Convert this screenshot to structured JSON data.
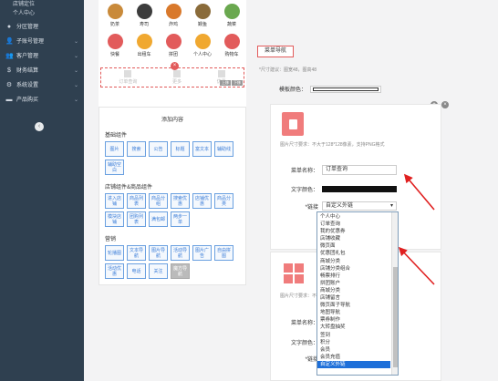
{
  "sidebar": {
    "top_items": [
      "店铺定位",
      "个人中心"
    ],
    "items": [
      {
        "label": "分区管理",
        "icon": "circle-icon"
      },
      {
        "label": "子账号管理",
        "icon": "user-icon"
      },
      {
        "label": "客户管理",
        "icon": "users-icon"
      },
      {
        "label": "财务结算",
        "icon": "dollar-icon"
      },
      {
        "label": "系统设置",
        "icon": "gear-icon"
      },
      {
        "label": "产品购买",
        "icon": "cart-icon"
      }
    ],
    "collapse_glyph": "‹"
  },
  "phone": {
    "icons": [
      {
        "label": "奶茶",
        "color": "#c98a3a"
      },
      {
        "label": "寿司",
        "color": "#3c3c3c"
      },
      {
        "label": "炸鸡",
        "color": "#d9792b"
      },
      {
        "label": "鳗鱼",
        "color": "#8a6b3a"
      },
      {
        "label": "蔬菜",
        "color": "#6aa84f"
      },
      {
        "label": "快餐",
        "color": "#e25b5b"
      },
      {
        "label": "出租车",
        "color": "#f0a830"
      },
      {
        "label": "拼团",
        "color": "#e25b5b"
      },
      {
        "label": "个人中心",
        "color": "#f0a830"
      },
      {
        "label": "购物车",
        "color": "#e25b5b"
      }
    ],
    "nav_row": {
      "left": "订单查询",
      "mid": "更多",
      "right": "优惠",
      "mini_btns": [
        "上移",
        "下移"
      ]
    },
    "badge": "×"
  },
  "add_panel": {
    "title": "添加内容",
    "sections": [
      {
        "name": "基础组件",
        "buttons": [
          "图片",
          "搜索",
          "公告",
          "标题",
          "富文本",
          "辅助线",
          "辅助空白"
        ]
      },
      {
        "name": "店铺组件&商品组件",
        "buttons": [
          "进入店铺",
          "商品列表",
          "商品分组",
          "搜索优惠",
          "店铺优惠",
          "商品分类",
          "模块店铺",
          "团购列表",
          "满包邮",
          "两步一单"
        ]
      },
      {
        "name": "营销",
        "buttons": [
          "轮播图",
          "文本导航",
          "图片导航",
          "活动导航",
          "图片广告",
          "自由拼图",
          "活动优惠",
          "电话",
          "关注",
          "魔方导航"
        ]
      }
    ]
  },
  "right": {
    "tab_label": "菜单导航",
    "size_note": "*尺寸建议：图宽48，图高48",
    "template_label": "模板颜色：",
    "card1": {
      "img_note": "图片尺寸要求：不大于128*128像素，支持PNG格式",
      "menu_name_label": "菜单名称：",
      "menu_name_value": "订单查询",
      "text_color_label": "文字颜色：",
      "link_label": "*链接",
      "link_value": "自定义外链",
      "close_glyph": "×",
      "add_glyph": "+"
    },
    "card2": {
      "img_note": "图片尺寸要求：不大于...",
      "menu_name_label": "菜单名称：",
      "text_color_label": "文字颜色：",
      "link_label": "*链接"
    },
    "dropdown_options": [
      "个人中心",
      "订单查询",
      "我的优惠券",
      "店铺收藏",
      "微页面",
      "优惠团礼包",
      "商城分类",
      "店铺分类组合",
      "畅票排行",
      "拼团账户",
      "商城分类",
      "店铺留言",
      "微页面子导航",
      "地图导航",
      "票券制作",
      "大转盘抽奖",
      "签到",
      "积分",
      "会员",
      "会员充值",
      "自定义外链"
    ],
    "dropdown_selected": "自定义外链"
  }
}
